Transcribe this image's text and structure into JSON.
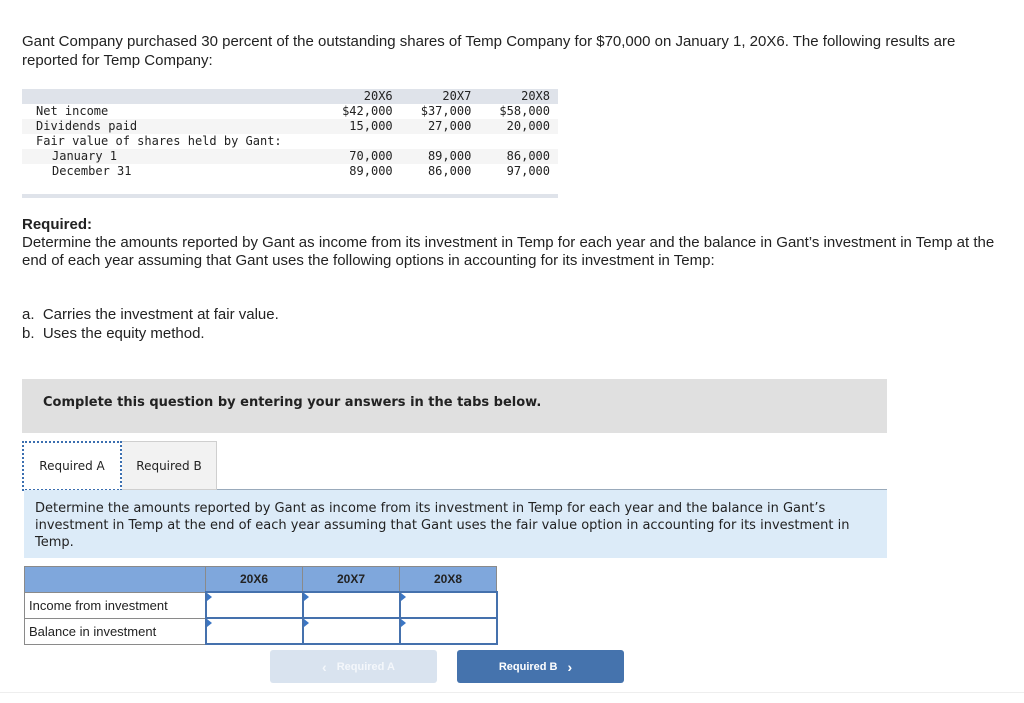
{
  "intro": "Gant Company purchased 30 percent of the outstanding shares of Temp Company for $70,000 on January 1, 20X6. The following results are reported for Temp Company:",
  "data_table": {
    "years": [
      "20X6",
      "20X7",
      "20X8"
    ],
    "rows": [
      {
        "label": "Net income",
        "values": [
          "$42,000",
          "$37,000",
          "$58,000"
        ]
      },
      {
        "label": "Dividends paid",
        "values": [
          "15,000",
          "27,000",
          "20,000"
        ]
      },
      {
        "label": "Fair value of shares held by Gant:",
        "values": [
          "",
          "",
          ""
        ]
      },
      {
        "label": "January 1",
        "values": [
          "70,000",
          "89,000",
          "86,000"
        ]
      },
      {
        "label": "December 31",
        "values": [
          "89,000",
          "86,000",
          "97,000"
        ]
      }
    ]
  },
  "required": {
    "title": "Required:",
    "text": "Determine the amounts reported by Gant as income from its investment in Temp for each year and the balance in Gant’s investment in Temp at the end of each year assuming that Gant uses the following options in accounting for its investment in Temp:",
    "options": [
      "a.  Carries the investment at fair value.",
      "b.  Uses the equity method."
    ]
  },
  "banner": "Complete this question by entering your answers in the tabs below.",
  "tabs": [
    {
      "label": "Required A",
      "active": true
    },
    {
      "label": "Required B",
      "active": false
    }
  ],
  "instruction": "Determine the amounts reported by Gant as income from its investment in Temp for each year and the balance in Gant’s investment in Temp at the end of each year assuming that Gant uses the fair value option in accounting for its investment in Temp.",
  "answer_table": {
    "headers": [
      "",
      "20X6",
      "20X7",
      "20X8"
    ],
    "rows": [
      {
        "label": "Income from investment",
        "values": [
          "",
          "",
          ""
        ]
      },
      {
        "label": "Balance in investment",
        "values": [
          "",
          "",
          ""
        ]
      }
    ]
  },
  "nav": {
    "prev_label": "Required A",
    "next_label": "Required B",
    "prev_icon": "‹",
    "next_icon": "›"
  }
}
